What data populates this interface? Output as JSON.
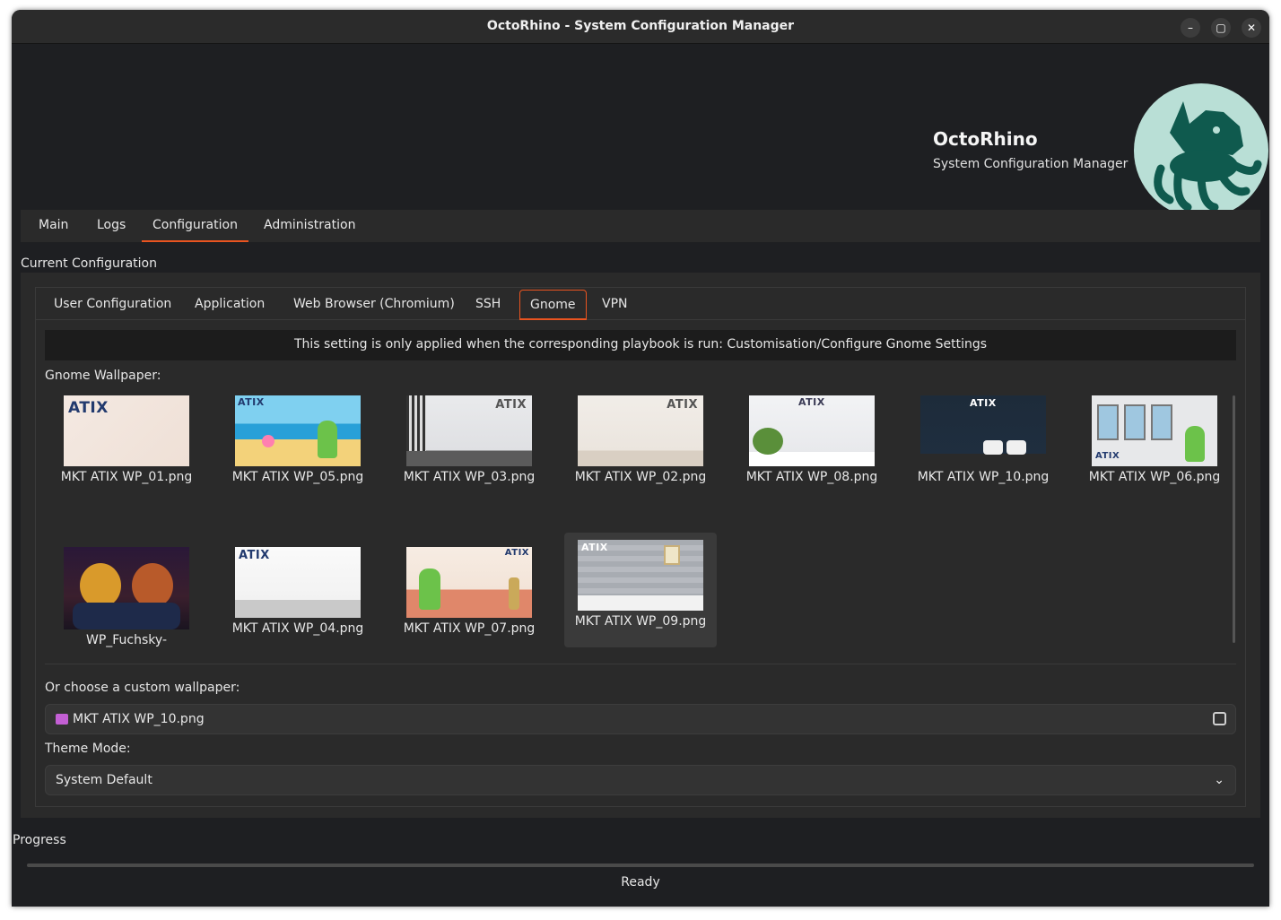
{
  "window": {
    "title": "OctoRhino - System Configuration Manager"
  },
  "titlebar_buttons": {
    "minimize": "–",
    "maximize": "▢",
    "close": "✕"
  },
  "brand": {
    "name": "OctoRhino",
    "subtitle": "System Configuration Manager"
  },
  "main_tabs": [
    "Main",
    "Logs",
    "Configuration",
    "Administration"
  ],
  "active_main_tab": "Configuration",
  "section_title": "Current Configuration",
  "sub_tabs": [
    "User Configuration",
    "Application",
    "Web Browser (Chromium)",
    "SSH",
    "Gnome",
    "VPN"
  ],
  "active_sub_tab": "Gnome",
  "notice": "This setting is only applied when the corresponding playbook is run: Customisation/Configure Gnome Settings",
  "wallpaper_label": "Gnome Wallpaper:",
  "wallpapers": [
    {
      "name": "MKT ATIX WP_01.png",
      "logo": "ATIX"
    },
    {
      "name": "MKT ATIX WP_05.png",
      "logo": "ATIX"
    },
    {
      "name": "MKT ATIX WP_03.png",
      "logo": "ATIX"
    },
    {
      "name": "MKT ATIX WP_02.png",
      "logo": "ATIX"
    },
    {
      "name": "MKT ATIX WP_08.png",
      "logo": "ATIX"
    },
    {
      "name": "MKT ATIX WP_10.png",
      "logo": "ATIX"
    },
    {
      "name": "MKT ATIX WP_06.png",
      "logo": "ATIX"
    },
    {
      "name": "WP_Fuchsky-",
      "logo": ""
    },
    {
      "name": "MKT ATIX WP_04.png",
      "logo": "ATIX"
    },
    {
      "name": "MKT ATIX WP_07.png",
      "logo": "ATIX"
    },
    {
      "name": "MKT ATIX WP_09.png",
      "logo": "ATIX"
    }
  ],
  "selected_wallpaper": "MKT ATIX WP_09.png",
  "custom_label": "Or choose a custom wallpaper:",
  "custom_value": "MKT ATIX WP_10.png",
  "theme_label": "Theme Mode:",
  "theme_value": "System Default",
  "progress_label": "Progress",
  "progress": 0,
  "status": "Ready",
  "colors": {
    "accent": "#e95420",
    "background": "#1e1f22",
    "panel": "#2a2a2a"
  }
}
